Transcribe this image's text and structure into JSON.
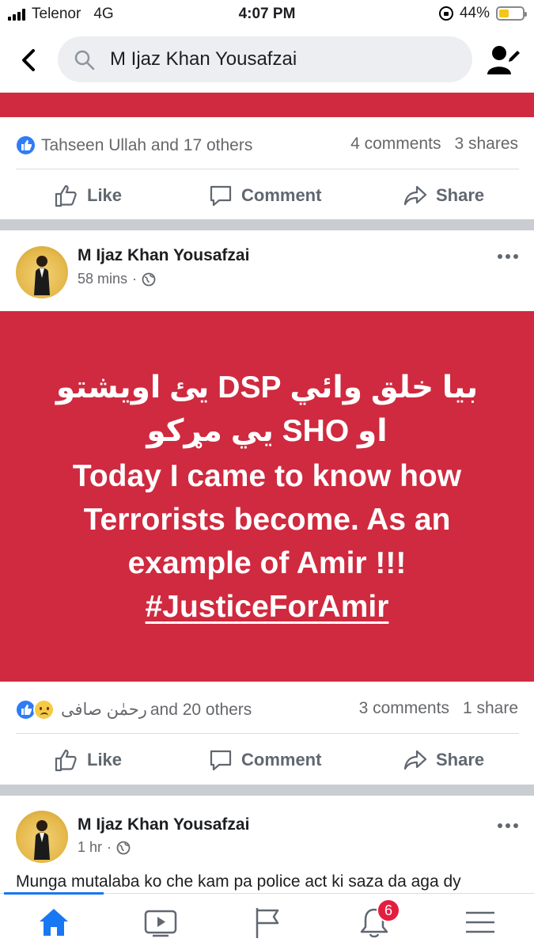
{
  "status": {
    "carrier": "Telenor",
    "network": "4G",
    "time": "4:07 PM",
    "battery": "44%",
    "battery_level": 0.44
  },
  "search": {
    "query": "M Ijaz Khan Yousafzai"
  },
  "prev_post": {
    "reactions_text": "Tahseen Ullah and 17 others",
    "comments": "4 comments",
    "shares": "3 shares"
  },
  "actions": {
    "like": "Like",
    "comment": "Comment",
    "share": "Share"
  },
  "post": {
    "author": "M Ijaz Khan Yousafzai",
    "time": "58 mins",
    "content_lines": [
      "بیا خلق وائي DSP يئ اویشتو",
      "او SHO يي مړکو",
      "Today I came to know how",
      "Terrorists become. As an",
      "example of Amir !!!"
    ],
    "hashtag": "#JusticeForAmir",
    "reactions_name": "رحمٰن صافی",
    "reactions_others": "and 20 others",
    "comments": "3 comments",
    "shares": "1 share"
  },
  "next_post": {
    "author": "M Ijaz Khan Yousafzai",
    "time": "1 hr",
    "snippet": "Munga mutalaba ko che kam pa police act ki saza da aga dy"
  },
  "tabbar": {
    "notifications_count": "6"
  },
  "colors": {
    "accent": "#1877f2",
    "post_bg": "#cf2a3f",
    "badge": "#e41e3f"
  }
}
